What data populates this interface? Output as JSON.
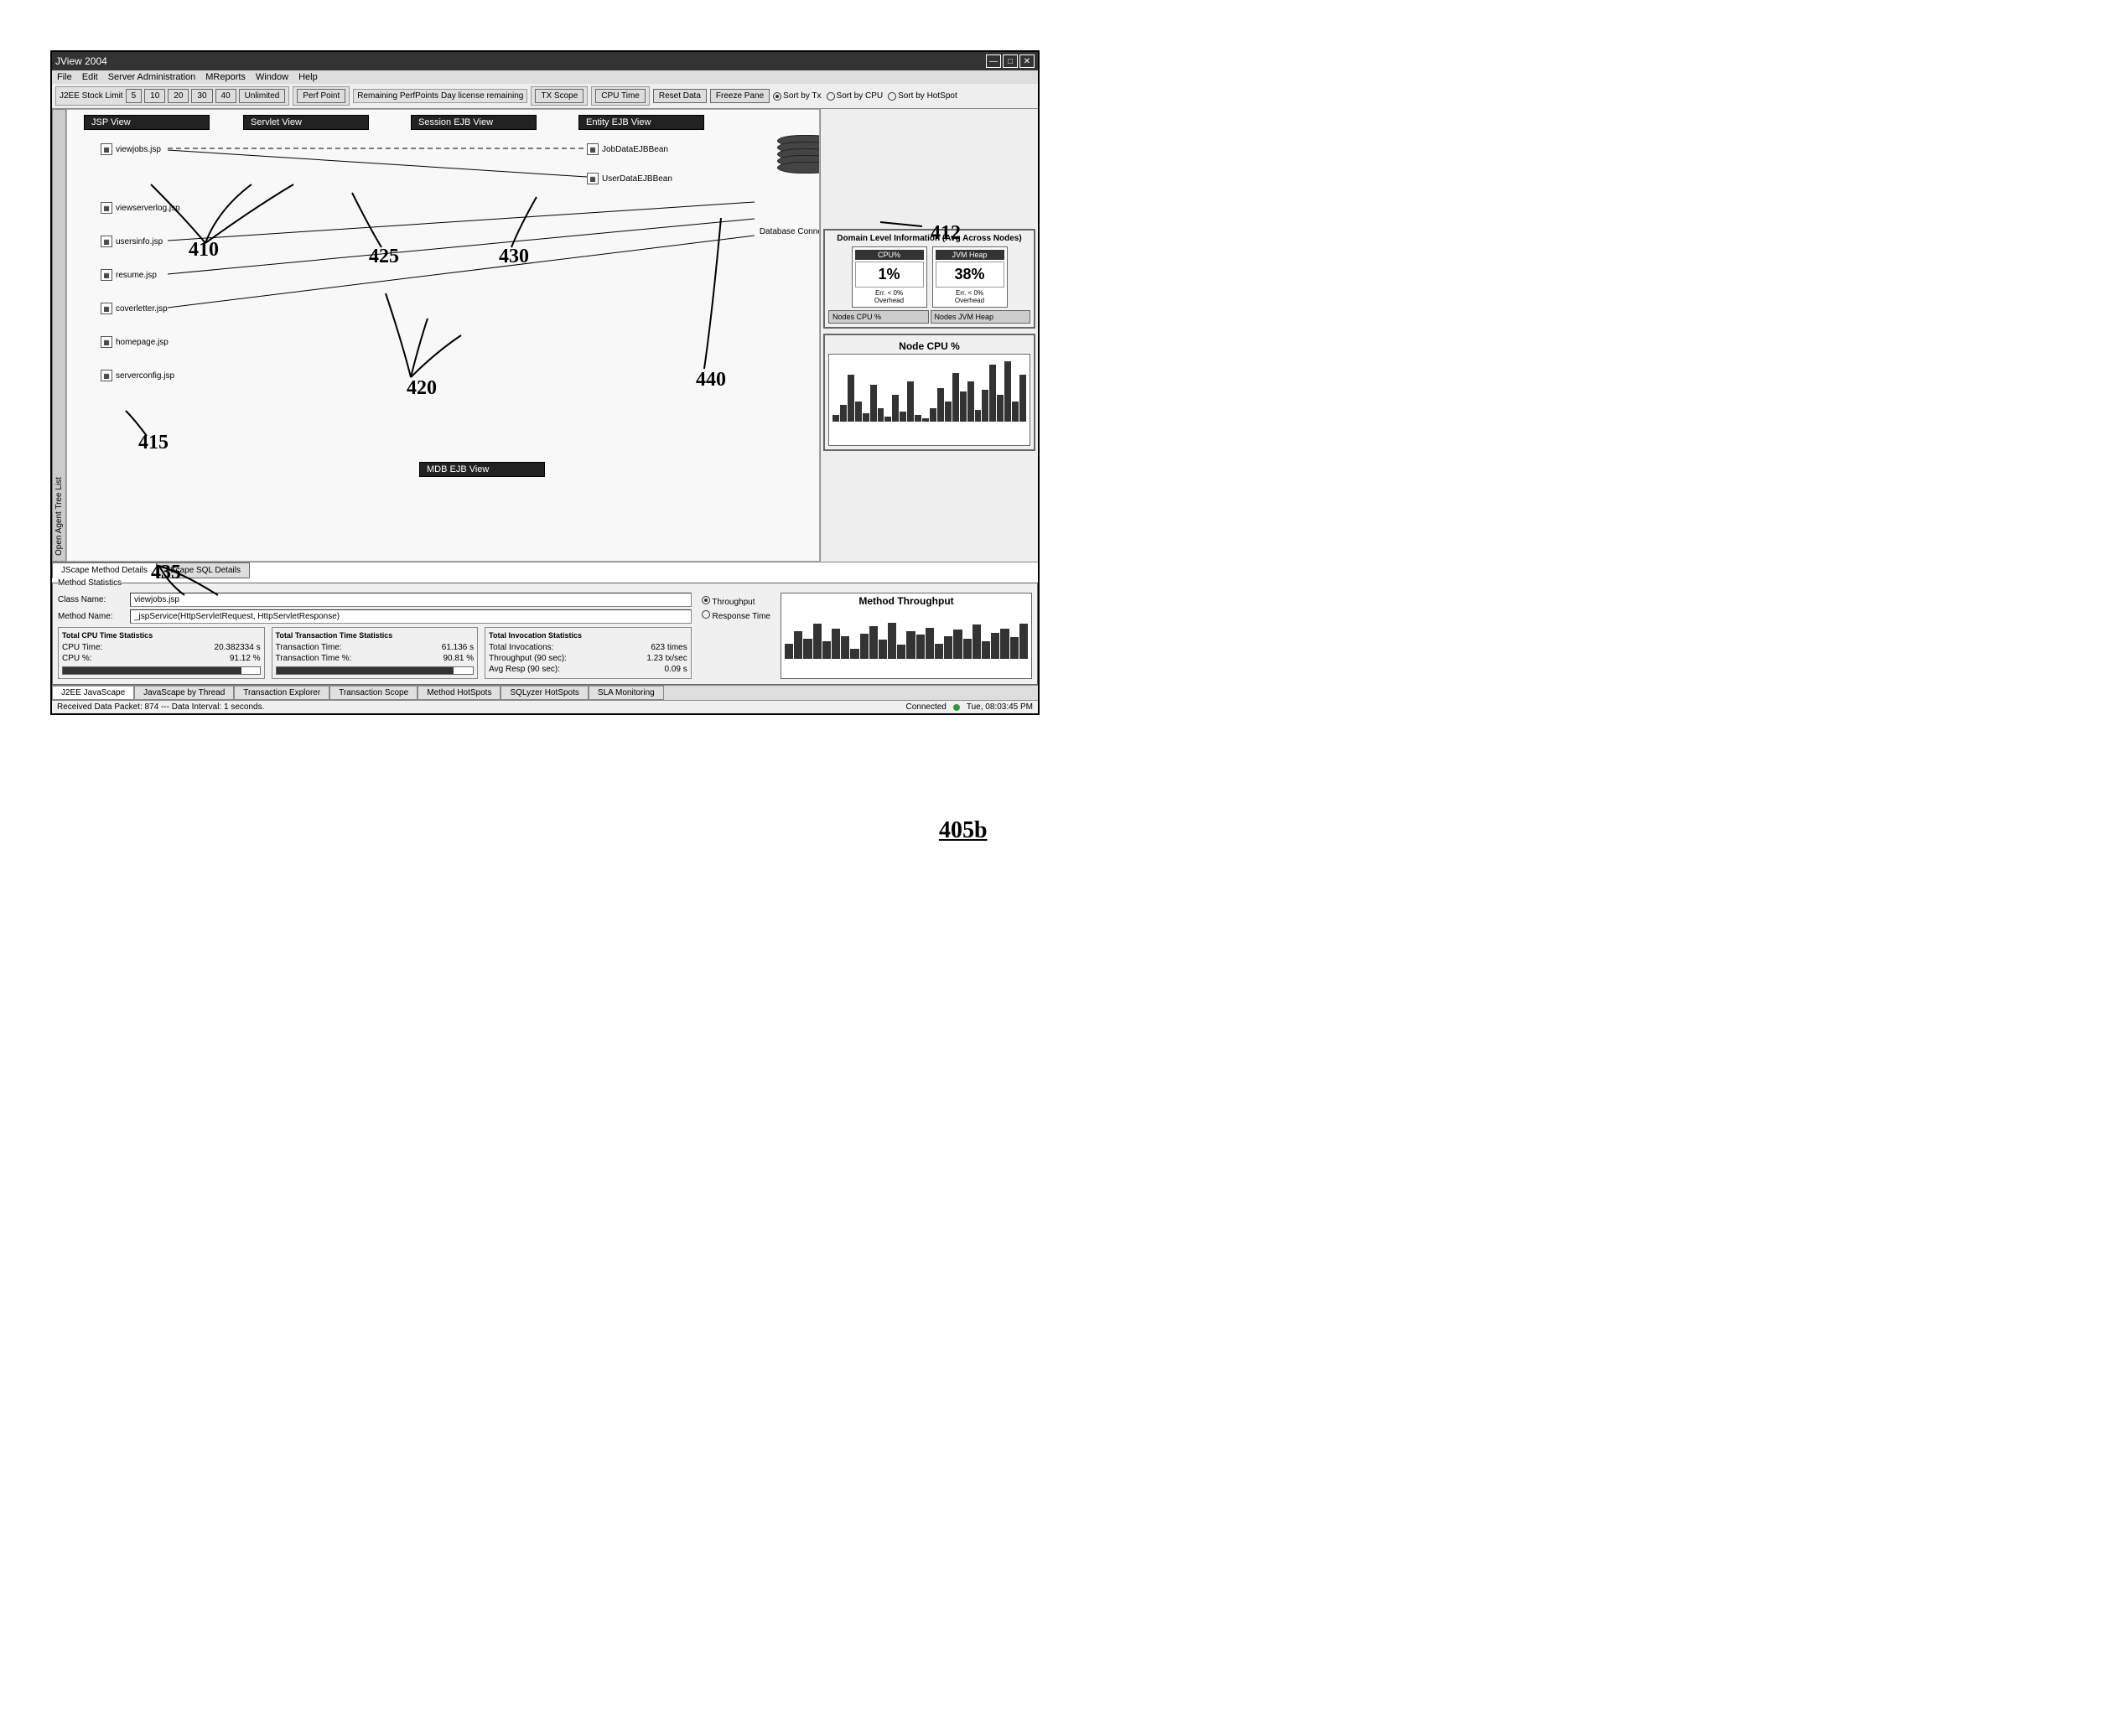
{
  "window": {
    "title": "JView 2004"
  },
  "menu": {
    "file": "File",
    "edit": "Edit",
    "server": "Server Administration",
    "reports": "MReports",
    "window": "Window",
    "help": "Help"
  },
  "toolbar": {
    "stock_label": "J2EE Stock Limit",
    "limits": [
      "5",
      "10",
      "20",
      "30",
      "40",
      "Unlimited"
    ],
    "perf_point": "Perf Point",
    "remaining_perf": "Remaining PerfPoints",
    "perf_remaining_val": "Day license remaining",
    "txscope": "TX Scope",
    "cputime": "CPU Time",
    "reset": "Reset Data",
    "freeze": "Freeze Pane",
    "sort_tx": "Sort by Tx",
    "sort_cpu": "Sort by CPU",
    "sort_hotspot": "Sort by HotSpot"
  },
  "sidebar": {
    "tab_label": "Open Agent Tree List"
  },
  "views": {
    "jsp": "JSP View",
    "servlet": "Servlet View",
    "session_ejb": "Session EJB View",
    "entity_ejb": "Entity EJB View",
    "mdb_ejb": "MDB EJB View"
  },
  "jsp_items": [
    {
      "name": "viewjobs.jsp"
    },
    {
      "name": "viewserverlog.jsp"
    },
    {
      "name": "usersinfo.jsp"
    },
    {
      "name": "resume.jsp"
    },
    {
      "name": "coverletter.jsp"
    },
    {
      "name": "homepage.jsp"
    },
    {
      "name": "serverconfig.jsp"
    }
  ],
  "ejb_items": [
    {
      "name": "JobDataEJBBean"
    },
    {
      "name": "UserDataEJBBean"
    }
  ],
  "db": {
    "label": "Database Connections"
  },
  "domain_panel": {
    "title": "Domain Level Information (Avg Across Nodes)",
    "cpu_label": "CPU%",
    "cpu_value": "1%",
    "cpu_sub": "Err. < 0%",
    "cpu_overhead": "Overhead",
    "heap_label": "JVM Heap",
    "heap_value": "38%",
    "heap_sub": "Err. < 0%",
    "heap_overhead": "Overhead",
    "tab_cpu": "Nodes CPU %",
    "tab_heap": "Nodes JVM Heap"
  },
  "node_chart": {
    "title": "Node CPU %"
  },
  "detail_tabs": {
    "method": "JScape Method Details",
    "sql": "JScape SQL Details"
  },
  "method_stats": {
    "section_title": "Method Statistics",
    "class_label": "Class Name:",
    "class_value": "viewjobs.jsp",
    "method_label": "Method Name:",
    "method_value": "_jspService(HttpServletRequest, HttpServletResponse)",
    "cpu_group": "Total CPU Time Statistics",
    "cpu_time_label": "CPU Time:",
    "cpu_time_value": "20.382334 s",
    "cpu_pct_label": "CPU %:",
    "cpu_pct_value": "91.12 %",
    "tx_group": "Total Transaction Time Statistics",
    "tx_time_label": "Transaction Time:",
    "tx_time_value": "61.136 s",
    "tx_pct_label": "Transaction Time %:",
    "tx_pct_value": "90.81 %",
    "inv_group": "Total Invocation Statistics",
    "inv_total_label": "Total Invocations:",
    "inv_total_value": "623 times",
    "inv_thr_label": "Throughput (90 sec):",
    "inv_thr_value": "1.23 tx/sec",
    "inv_resp_label": "Avg Resp (90 sec):",
    "inv_resp_value": "0.09 s",
    "radio_throughput": "Throughput",
    "radio_response": "Response Time",
    "chart_title": "Method Throughput"
  },
  "footer_tabs": [
    "J2EE JavaScape",
    "JavaScape by Thread",
    "Transaction Explorer",
    "Transaction Scope",
    "Method HotSpots",
    "SQLyzer HotSpots",
    "SLA Monitoring"
  ],
  "statusbar": {
    "left": "Received Data Packet: 874 --- Data Interval: 1 seconds.",
    "connected": "Connected",
    "time": "Tue, 08:03:45 PM"
  },
  "annotations": {
    "a410": "410",
    "a412": "412",
    "a415": "415",
    "a420": "420",
    "a425": "425",
    "a430": "430",
    "a435": "435",
    "a440": "440",
    "figure": "405b"
  },
  "chart_data": {
    "type": "bar",
    "title": "Node CPU %",
    "categories": [],
    "values": [
      10,
      25,
      70,
      30,
      12,
      55,
      20,
      8,
      40,
      15,
      60,
      10,
      5,
      20,
      50,
      30,
      72,
      45,
      60,
      18,
      48,
      85,
      40,
      90,
      30,
      70
    ]
  }
}
